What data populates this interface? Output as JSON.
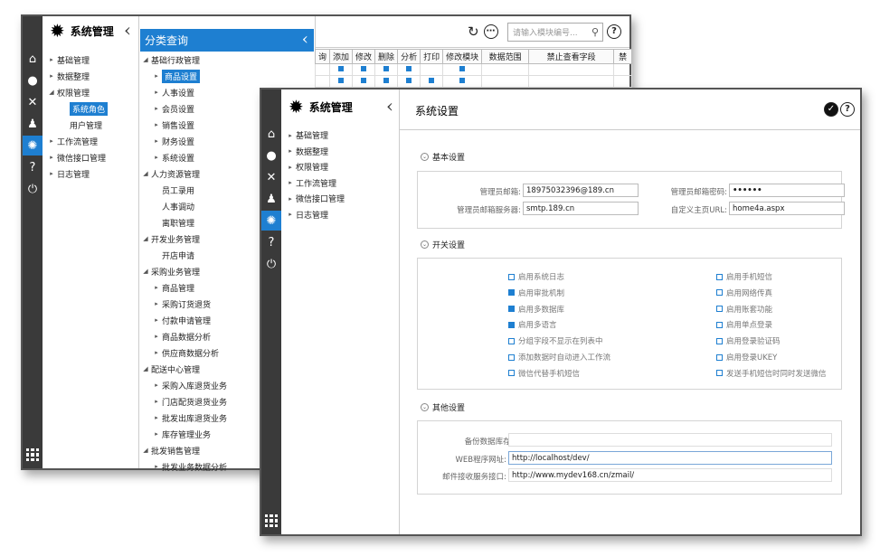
{
  "back": {
    "title": "系统管理",
    "menu": [
      {
        "label": "基础管理",
        "arrow": "▸"
      },
      {
        "label": "数据整理",
        "arrow": "▸"
      },
      {
        "label": "权限管理",
        "arrow": "◢"
      },
      {
        "label": "系统角色",
        "arrow": "",
        "selected": true,
        "sub": true
      },
      {
        "label": "用户管理",
        "arrow": "",
        "sub": true
      },
      {
        "label": "工作流管理",
        "arrow": "▸"
      },
      {
        "label": "微信接口管理",
        "arrow": "▸"
      },
      {
        "label": "日志管理",
        "arrow": "▸"
      }
    ],
    "category_title": "分类查询",
    "categories": [
      {
        "label": "基础行政管理",
        "level": 0,
        "arrow": "◢"
      },
      {
        "label": "商品设置",
        "level": 1,
        "arrow": "▸",
        "selected": true
      },
      {
        "label": "人事设置",
        "level": 1,
        "arrow": "▸"
      },
      {
        "label": "会员设置",
        "level": 1,
        "arrow": "▸"
      },
      {
        "label": "销售设置",
        "level": 1,
        "arrow": "▸"
      },
      {
        "label": "财务设置",
        "level": 1,
        "arrow": "▸"
      },
      {
        "label": "系统设置",
        "level": 1,
        "arrow": "▸"
      },
      {
        "label": "人力资源管理",
        "level": 0,
        "arrow": "◢"
      },
      {
        "label": "员工录用",
        "level": 1,
        "arrow": ""
      },
      {
        "label": "人事调动",
        "level": 1,
        "arrow": ""
      },
      {
        "label": "离职管理",
        "level": 1,
        "arrow": ""
      },
      {
        "label": "开发业务管理",
        "level": 0,
        "arrow": "◢"
      },
      {
        "label": "开店申请",
        "level": 1,
        "arrow": ""
      },
      {
        "label": "采购业务管理",
        "level": 0,
        "arrow": "◢"
      },
      {
        "label": "商品管理",
        "level": 1,
        "arrow": "▸"
      },
      {
        "label": "采购订货退货",
        "level": 1,
        "arrow": "▸"
      },
      {
        "label": "付款申请管理",
        "level": 1,
        "arrow": "▸"
      },
      {
        "label": "商品数据分析",
        "level": 1,
        "arrow": "▸"
      },
      {
        "label": "供应商数据分析",
        "level": 1,
        "arrow": "▸"
      },
      {
        "label": "配送中心管理",
        "level": 0,
        "arrow": "◢"
      },
      {
        "label": "采购入库退货业务",
        "level": 1,
        "arrow": "▸"
      },
      {
        "label": "门店配货退货业务",
        "level": 1,
        "arrow": "▸"
      },
      {
        "label": "批发出库退货业务",
        "level": 1,
        "arrow": "▸"
      },
      {
        "label": "库存管理业务",
        "level": 1,
        "arrow": "▸"
      },
      {
        "label": "批发销售管理",
        "level": 0,
        "arrow": "◢"
      },
      {
        "label": "批发业务数据分析",
        "level": 1,
        "arrow": "▸"
      }
    ],
    "columns": [
      "询",
      "添加",
      "修改",
      "删除",
      "分析",
      "打印",
      "修改模块",
      "数据范围",
      "禁止查看字段",
      "禁"
    ],
    "search_placeholder": "请输入模块编号..."
  },
  "front": {
    "title": "系统管理",
    "panel_title": "系统设置",
    "menu": [
      "基础管理",
      "数据整理",
      "权限管理",
      "工作流管理",
      "微信接口管理",
      "日志管理"
    ],
    "sections": {
      "basic": "基本设置",
      "switch": "开关设置",
      "other": "其他设置"
    },
    "basic": {
      "admin_email_label": "管理员邮箱:",
      "admin_email": "18975032396@189.cn",
      "admin_pwd_label": "管理员邮箱密码:",
      "admin_pwd": "••••••",
      "smtp_label": "管理员邮箱服务器:",
      "smtp": "smtp.189.cn",
      "home_label": "自定义主页URL:",
      "home": "home4a.aspx"
    },
    "switches_left": [
      {
        "label": "启用系统日志",
        "checked": false
      },
      {
        "label": "启用审批机制",
        "checked": true
      },
      {
        "label": "启用多数据库",
        "checked": true
      },
      {
        "label": "启用多语言",
        "checked": true
      },
      {
        "label": "分组字段不显示在列表中",
        "checked": false
      },
      {
        "label": "添加数据时自动进入工作流",
        "checked": false
      },
      {
        "label": "微信代替手机短信",
        "checked": false
      }
    ],
    "switches_right": [
      {
        "label": "启用手机短信",
        "checked": false
      },
      {
        "label": "启用网络传真",
        "checked": false
      },
      {
        "label": "启用账套功能",
        "checked": false
      },
      {
        "label": "启用单点登录",
        "checked": false
      },
      {
        "label": "启用登录验证码",
        "checked": false
      },
      {
        "label": "启用登录UKEY",
        "checked": false
      },
      {
        "label": "发送手机短信时同时发送微信",
        "checked": false
      }
    ],
    "other": {
      "backup_label": "备份数据库存放:",
      "backup": "",
      "web_label": "WEB程序网址:",
      "web": "http://localhost/dev/",
      "mail_label": "邮件接收服务接口:",
      "mail": "http://www.mydev168.cn/zmail/"
    }
  }
}
